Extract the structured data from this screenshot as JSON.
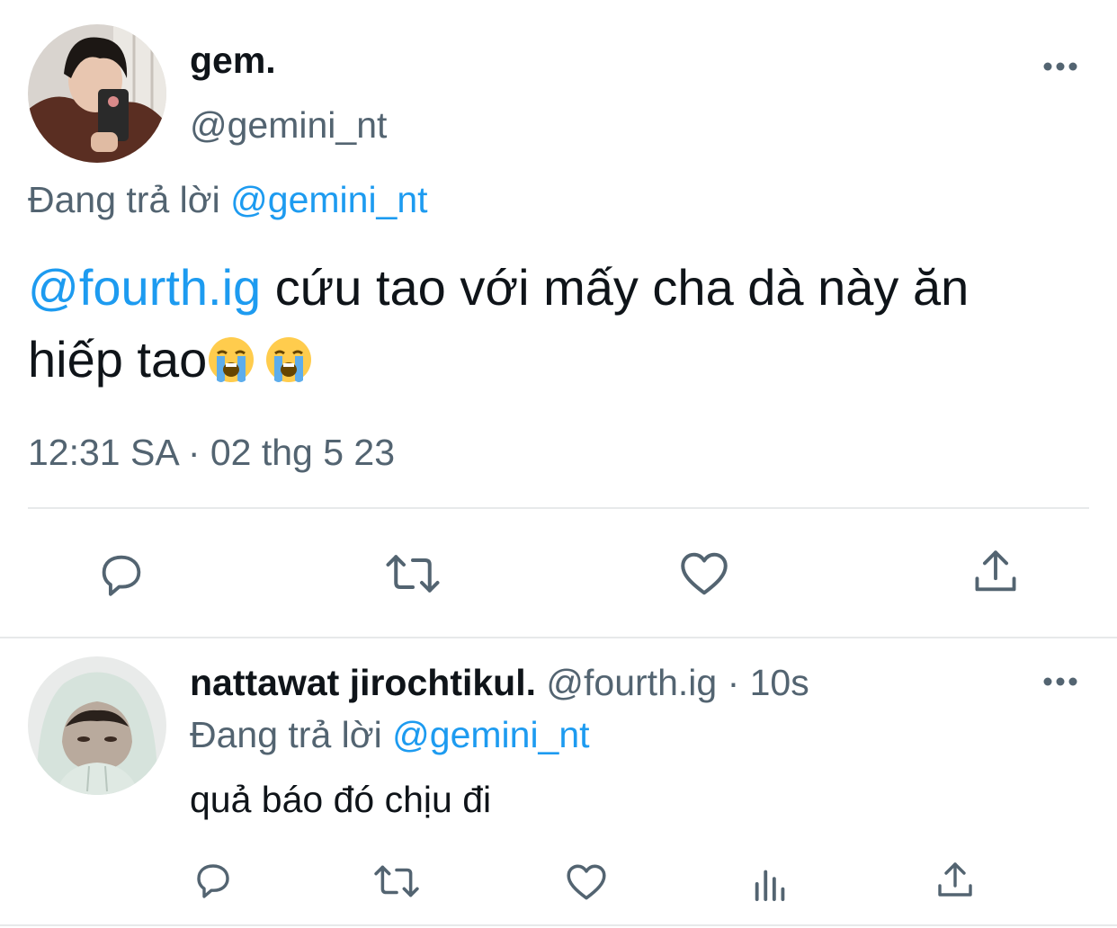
{
  "main_tweet": {
    "display_name": "gem.",
    "handle": "@gemini_nt",
    "replying_prefix": "Đang trả lời",
    "replying_to": "@gemini_nt",
    "mention": "@fourth.ig",
    "text_rest_line1": " cứu tao với mấy cha dà này ăn",
    "text_line2": "hiếp tao",
    "emojis": [
      "loudly-crying-face",
      "loudly-crying-face"
    ],
    "timestamp": "12:31 SA · 02 thg 5 23",
    "actions": [
      "reply-icon",
      "retweet-icon",
      "like-icon",
      "share-icon"
    ]
  },
  "reply_tweet": {
    "display_name": "nattawat jirochtikul.",
    "handle": "@fourth.ig",
    "time": "· 10s",
    "replying_prefix": "Đang trả lời",
    "replying_to": "@gemini_nt",
    "text": "quả báo đó chịu đi",
    "actions": [
      "reply-icon",
      "retweet-icon",
      "like-icon",
      "views-icon",
      "share-icon"
    ]
  },
  "colors": {
    "accent": "#1d9bf0",
    "muted": "#536471",
    "text": "#0f1419",
    "divider": "#e7e9ea"
  }
}
